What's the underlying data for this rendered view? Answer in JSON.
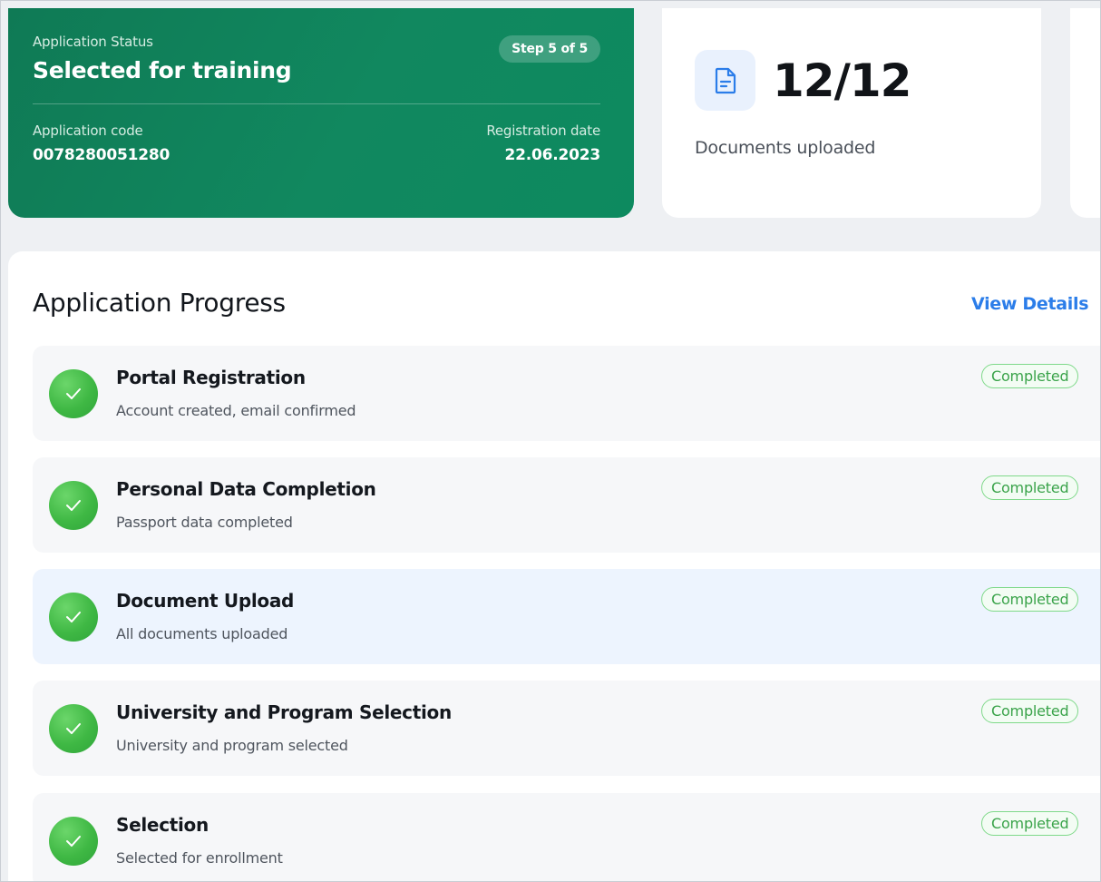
{
  "status_card": {
    "label": "Application Status",
    "title": "Selected for training",
    "step_badge": "Step 5 of 5",
    "code_label": "Application code",
    "code_value": "0078280051280",
    "date_label": "Registration date",
    "date_value": "22.06.2023",
    "colors": {
      "background": "#0f7a55"
    }
  },
  "documents_card": {
    "icon": "document-icon",
    "count": "12/12",
    "label": "Documents uploaded"
  },
  "progress": {
    "title": "Application Progress",
    "view_details": "View Details",
    "steps": [
      {
        "title": "Portal Registration",
        "description": "Account created, email confirmed",
        "status": "Completed",
        "icon": "check-icon"
      },
      {
        "title": "Personal Data Completion",
        "description": "Passport data completed",
        "status": "Completed",
        "icon": "check-icon"
      },
      {
        "title": "Document Upload",
        "description": "All documents uploaded",
        "status": "Completed",
        "icon": "check-icon"
      },
      {
        "title": "University and Program Selection",
        "description": "University and program selected",
        "status": "Completed",
        "icon": "check-icon"
      },
      {
        "title": "Selection",
        "description": "Selected for enrollment",
        "status": "Completed",
        "icon": "check-icon"
      }
    ],
    "colors": {
      "accent": "#2b7de9",
      "success": "#3fb844"
    }
  }
}
